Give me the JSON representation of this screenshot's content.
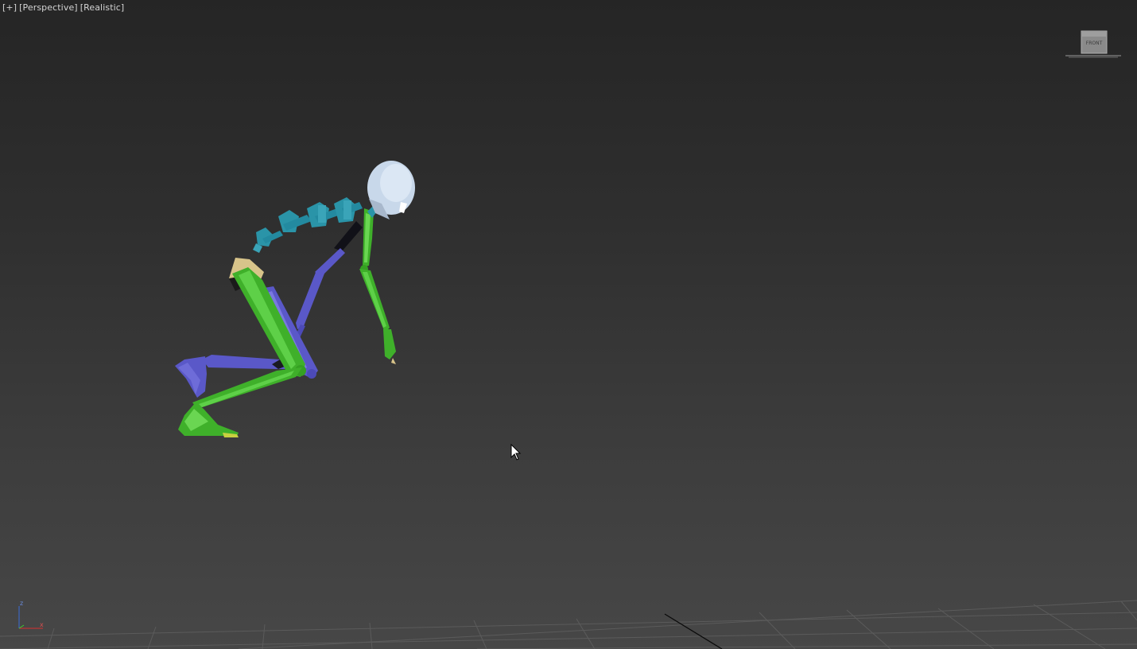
{
  "viewport": {
    "menu_label": "[+]",
    "view_label": "[Perspective]",
    "shading_label": "[Realistic]"
  },
  "viewcube": {
    "face_label": "FRONT"
  },
  "axis_gizmo": {
    "z_label": "z",
    "x_label": "x"
  },
  "colors": {
    "background_top": "#252525",
    "background_bottom": "#474747",
    "biped_left_limbs": "#3fb02a",
    "biped_right_limbs": "#5a58c8",
    "biped_spine": "#2a94a8",
    "biped_head": "#c8d8ea",
    "biped_pelvis": "#d8c48a",
    "grid_lines": "#5a5a5a"
  },
  "icons": {
    "cursor": "mouse-pointer-icon",
    "viewcube": "viewcube-icon",
    "axis": "axis-tripod-icon"
  }
}
